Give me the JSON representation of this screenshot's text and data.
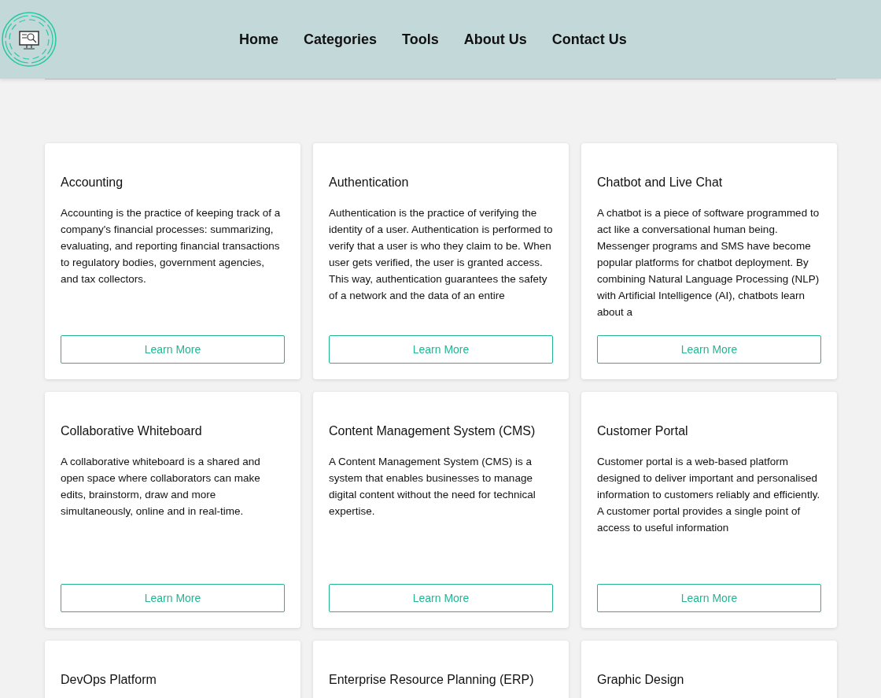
{
  "nav": [
    {
      "label": "Home"
    },
    {
      "label": "Categories"
    },
    {
      "label": "Tools"
    },
    {
      "label": "About Us"
    },
    {
      "label": "Contact Us"
    }
  ],
  "cards": [
    {
      "title": "Accounting",
      "text": "Accounting is the practice of keeping track of a company's financial processes: summarizing, evaluating, and reporting financial transactions to regulatory bodies, government agencies, and tax collectors.",
      "button": "Learn More"
    },
    {
      "title": "Authentication",
      "text": "Authentication is the practice of verifying the identity of a user. Authentication is performed to verify that a user is who they claim to be. When user gets verified, the user is granted access. This way, authentication guarantees the safety of a network and the data of an entire",
      "button": "Learn More"
    },
    {
      "title": "Chatbot and Live Chat",
      "text": "A chatbot is a piece of software programmed to act like a conversational human being. Messenger programs and SMS have become popular platforms for chatbot deployment. By combining Natural Language Processing (NLP) with Artificial Intelligence (AI), chatbots learn about a",
      "button": "Learn More"
    },
    {
      "title": "Collaborative Whiteboard",
      "text": "A collaborative whiteboard is a shared and open space where collaborators can make edits, brainstorm, draw and more simultaneously, online and in real-time.",
      "button": "Learn More"
    },
    {
      "title": "Content Management System (CMS)",
      "text": "A Content Management System (CMS) is a system that enables businesses to manage digital content without the need for technical expertise.",
      "button": "Learn More"
    },
    {
      "title": "Customer Portal",
      "text": "Customer portal is a web-based platform designed to deliver important and personalised information to customers reliably and efficiently. A customer portal provides a single point of access to useful information",
      "button": "Learn More"
    },
    {
      "title": "DevOps Platform"
    },
    {
      "title": "Enterprise Resource Planning (ERP)"
    },
    {
      "title": "Graphic Design"
    }
  ]
}
